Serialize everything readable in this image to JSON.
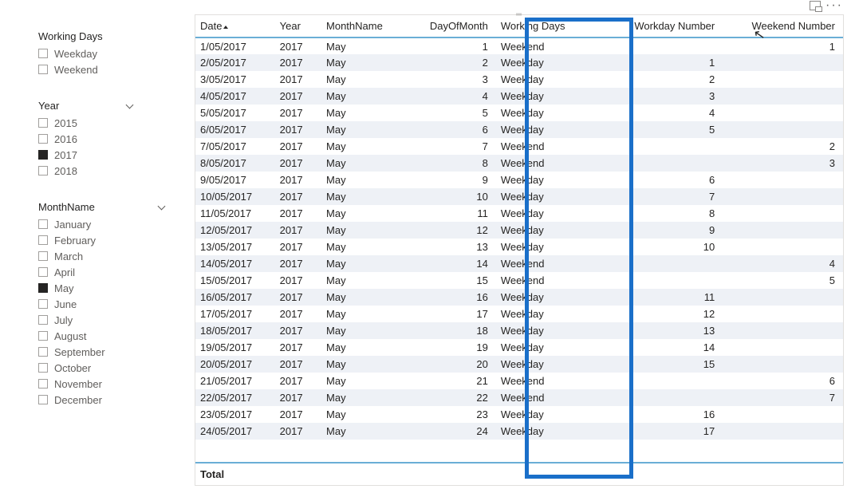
{
  "slicers": {
    "working_days": {
      "title": "Working Days",
      "items": [
        {
          "label": "Weekday",
          "checked": false
        },
        {
          "label": "Weekend",
          "checked": false
        }
      ]
    },
    "year": {
      "title": "Year",
      "items": [
        {
          "label": "2015",
          "checked": false
        },
        {
          "label": "2016",
          "checked": false
        },
        {
          "label": "2017",
          "checked": true
        },
        {
          "label": "2018",
          "checked": false
        }
      ]
    },
    "month": {
      "title": "MonthName",
      "items": [
        {
          "label": "January",
          "checked": false
        },
        {
          "label": "February",
          "checked": false
        },
        {
          "label": "March",
          "checked": false
        },
        {
          "label": "April",
          "checked": false
        },
        {
          "label": "May",
          "checked": true
        },
        {
          "label": "June",
          "checked": false
        },
        {
          "label": "July",
          "checked": false
        },
        {
          "label": "August",
          "checked": false
        },
        {
          "label": "September",
          "checked": false
        },
        {
          "label": "October",
          "checked": false
        },
        {
          "label": "November",
          "checked": false
        },
        {
          "label": "December",
          "checked": false
        }
      ]
    }
  },
  "table": {
    "headers": [
      "Date",
      "Year",
      "MonthName",
      "DayOfMonth",
      "Working Days",
      "Workday Number",
      "Weekend Number"
    ],
    "total_label": "Total",
    "rows": [
      {
        "date": "1/05/2017",
        "year": "2017",
        "month": "May",
        "dom": "1",
        "wd": "Weekend",
        "wdn": "",
        "wen": "1"
      },
      {
        "date": "2/05/2017",
        "year": "2017",
        "month": "May",
        "dom": "2",
        "wd": "Weekday",
        "wdn": "1",
        "wen": ""
      },
      {
        "date": "3/05/2017",
        "year": "2017",
        "month": "May",
        "dom": "3",
        "wd": "Weekday",
        "wdn": "2",
        "wen": ""
      },
      {
        "date": "4/05/2017",
        "year": "2017",
        "month": "May",
        "dom": "4",
        "wd": "Weekday",
        "wdn": "3",
        "wen": ""
      },
      {
        "date": "5/05/2017",
        "year": "2017",
        "month": "May",
        "dom": "5",
        "wd": "Weekday",
        "wdn": "4",
        "wen": ""
      },
      {
        "date": "6/05/2017",
        "year": "2017",
        "month": "May",
        "dom": "6",
        "wd": "Weekday",
        "wdn": "5",
        "wen": ""
      },
      {
        "date": "7/05/2017",
        "year": "2017",
        "month": "May",
        "dom": "7",
        "wd": "Weekend",
        "wdn": "",
        "wen": "2"
      },
      {
        "date": "8/05/2017",
        "year": "2017",
        "month": "May",
        "dom": "8",
        "wd": "Weekend",
        "wdn": "",
        "wen": "3"
      },
      {
        "date": "9/05/2017",
        "year": "2017",
        "month": "May",
        "dom": "9",
        "wd": "Weekday",
        "wdn": "6",
        "wen": ""
      },
      {
        "date": "10/05/2017",
        "year": "2017",
        "month": "May",
        "dom": "10",
        "wd": "Weekday",
        "wdn": "7",
        "wen": ""
      },
      {
        "date": "11/05/2017",
        "year": "2017",
        "month": "May",
        "dom": "11",
        "wd": "Weekday",
        "wdn": "8",
        "wen": ""
      },
      {
        "date": "12/05/2017",
        "year": "2017",
        "month": "May",
        "dom": "12",
        "wd": "Weekday",
        "wdn": "9",
        "wen": ""
      },
      {
        "date": "13/05/2017",
        "year": "2017",
        "month": "May",
        "dom": "13",
        "wd": "Weekday",
        "wdn": "10",
        "wen": ""
      },
      {
        "date": "14/05/2017",
        "year": "2017",
        "month": "May",
        "dom": "14",
        "wd": "Weekend",
        "wdn": "",
        "wen": "4"
      },
      {
        "date": "15/05/2017",
        "year": "2017",
        "month": "May",
        "dom": "15",
        "wd": "Weekend",
        "wdn": "",
        "wen": "5"
      },
      {
        "date": "16/05/2017",
        "year": "2017",
        "month": "May",
        "dom": "16",
        "wd": "Weekday",
        "wdn": "11",
        "wen": ""
      },
      {
        "date": "17/05/2017",
        "year": "2017",
        "month": "May",
        "dom": "17",
        "wd": "Weekday",
        "wdn": "12",
        "wen": ""
      },
      {
        "date": "18/05/2017",
        "year": "2017",
        "month": "May",
        "dom": "18",
        "wd": "Weekday",
        "wdn": "13",
        "wen": ""
      },
      {
        "date": "19/05/2017",
        "year": "2017",
        "month": "May",
        "dom": "19",
        "wd": "Weekday",
        "wdn": "14",
        "wen": ""
      },
      {
        "date": "20/05/2017",
        "year": "2017",
        "month": "May",
        "dom": "20",
        "wd": "Weekday",
        "wdn": "15",
        "wen": ""
      },
      {
        "date": "21/05/2017",
        "year": "2017",
        "month": "May",
        "dom": "21",
        "wd": "Weekend",
        "wdn": "",
        "wen": "6"
      },
      {
        "date": "22/05/2017",
        "year": "2017",
        "month": "May",
        "dom": "22",
        "wd": "Weekend",
        "wdn": "",
        "wen": "7"
      },
      {
        "date": "23/05/2017",
        "year": "2017",
        "month": "May",
        "dom": "23",
        "wd": "Weekday",
        "wdn": "16",
        "wen": ""
      },
      {
        "date": "24/05/2017",
        "year": "2017",
        "month": "May",
        "dom": "24",
        "wd": "Weekday",
        "wdn": "17",
        "wen": ""
      }
    ]
  }
}
